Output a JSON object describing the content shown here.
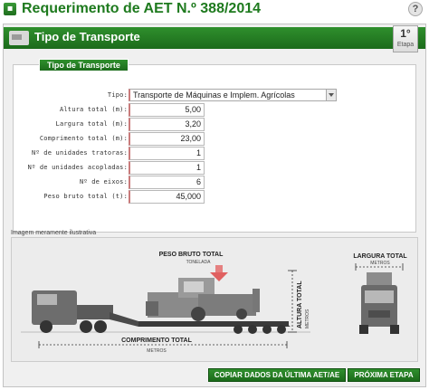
{
  "header": {
    "title": "Requerimento de AET N.º 388/2014",
    "help_label": "?"
  },
  "panel": {
    "title": "Tipo de Transporte",
    "stage_number": "1°",
    "stage_label": "Etapa"
  },
  "form": {
    "legend": "Tipo de Transporte",
    "fields": [
      {
        "label": "Tipo:",
        "value": "Transporte de Máquinas e Implem. Agrícolas"
      },
      {
        "label": "Altura total (m):",
        "value": "5,00"
      },
      {
        "label": "Largura total (m):",
        "value": "3,20"
      },
      {
        "label": "Comprimento total (m):",
        "value": "23,00"
      },
      {
        "label": "Nº de unidades tratoras:",
        "value": "1"
      },
      {
        "label": "Nº de unidades acopladas:",
        "value": "1"
      },
      {
        "label": "Nº de eixos:",
        "value": "6"
      },
      {
        "label": "Peso bruto total (t):",
        "value": "45,000"
      }
    ]
  },
  "illustration": {
    "caption": "Imagem meramente ilustrativa",
    "peso_label": "PESO BRUTO TOTAL",
    "peso_unit": "TONELADA",
    "altura_label": "ALTURA TOTAL",
    "altura_unit": "METROS",
    "largura_label": "LARGURA TOTAL",
    "largura_unit": "METROS",
    "comprimento_label": "COMPRIMENTO TOTAL",
    "comprimento_unit": "METROS"
  },
  "actions": {
    "copy_label": "COPIAR DADOS DA ÚLTIMA AET/AE",
    "next_label": "PRÓXIMA ETAPA"
  },
  "colors": {
    "brand_green": "#1e7a1e",
    "required_marker": "#c97b7b"
  }
}
